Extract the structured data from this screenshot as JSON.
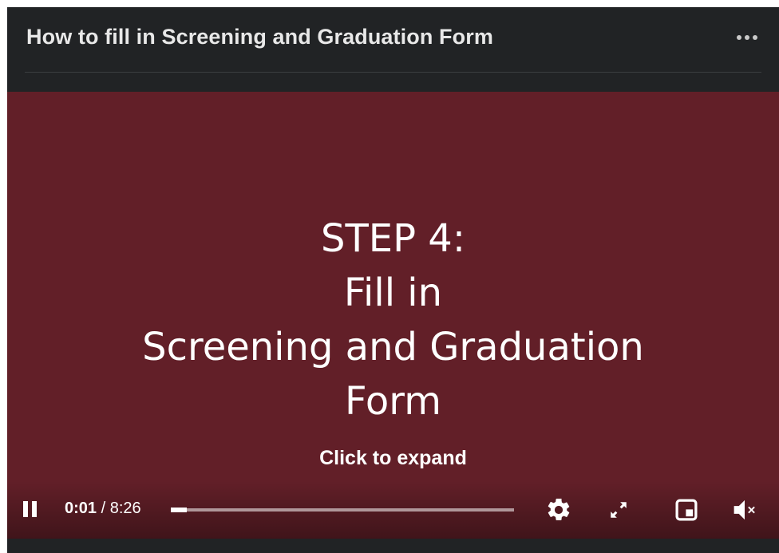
{
  "header": {
    "title": "How to fill in Screening and Graduation Form",
    "more_icon": "more-horizontal-icon"
  },
  "slide": {
    "lines": [
      "STEP 4:",
      "Fill in",
      "Screening and Graduation",
      "Form"
    ],
    "background": "#621f28",
    "expand_hint": "Click to expand"
  },
  "player": {
    "current_time": "0:01",
    "separator": " / ",
    "duration": "8:26",
    "progress_fraction": 0.02,
    "icons": [
      "pause-icon",
      "settings-gear-icon",
      "fullscreen-icon",
      "picture-in-picture-icon",
      "muted-speaker-icon"
    ]
  }
}
